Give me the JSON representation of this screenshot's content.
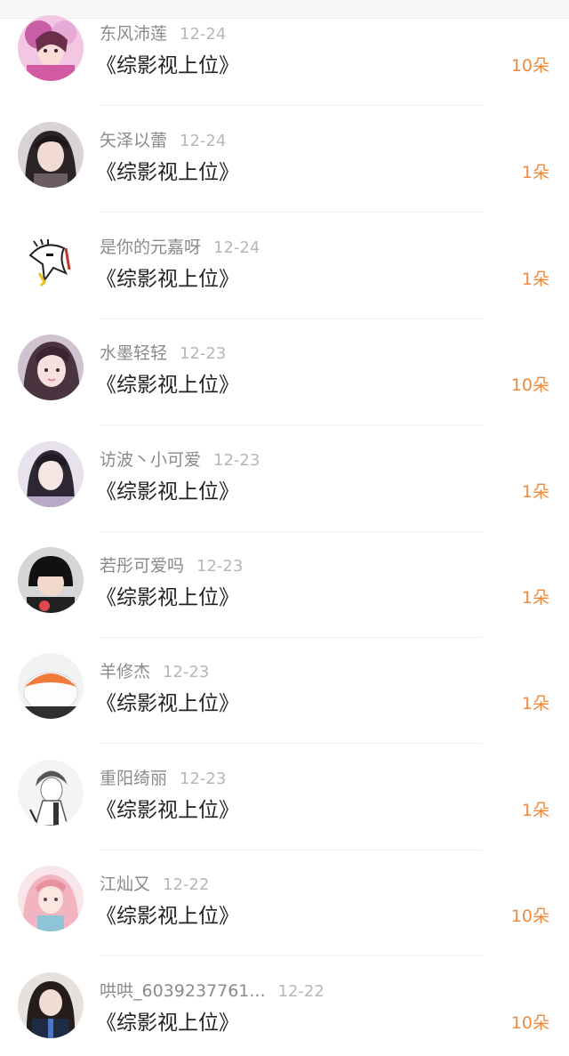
{
  "colors": {
    "accent": "#ef8a3c",
    "name_text": "#8a8a8a",
    "date_text": "#b7b7b7",
    "title_text": "#222222"
  },
  "rows": [
    {
      "name": "东风沛莲",
      "date": "12-24",
      "book": "《综影视上位》",
      "amount": "10朵",
      "avatar": "anime-girl-avatar"
    },
    {
      "name": "矢泽以蕾",
      "date": "12-24",
      "book": "《综影视上位》",
      "amount": "1朵",
      "avatar": "girl-photo-avatar"
    },
    {
      "name": "是你的元嘉呀",
      "date": "12-24",
      "book": "《综影视上位》",
      "amount": "1朵",
      "avatar": "sketch-bird-avatar"
    },
    {
      "name": "水墨轻轻",
      "date": "12-23",
      "book": "《综影视上位》",
      "amount": "10朵",
      "avatar": "girl-photo-avatar"
    },
    {
      "name": "访波丶小可爱",
      "date": "12-23",
      "book": "《综影视上位》",
      "amount": "1朵",
      "avatar": "girl-photo-avatar"
    },
    {
      "name": "若彤可爱吗",
      "date": "12-23",
      "book": "《综影视上位》",
      "amount": "1朵",
      "avatar": "child-photo-avatar"
    },
    {
      "name": "羊修杰",
      "date": "12-23",
      "book": "《综影视上位》",
      "amount": "1朵",
      "avatar": "sushi-avatar"
    },
    {
      "name": "重阳绮丽",
      "date": "12-23",
      "book": "《综影视上位》",
      "amount": "1朵",
      "avatar": "sketch-boy-avatar"
    },
    {
      "name": "江灿又",
      "date": "12-22",
      "book": "《综影视上位》",
      "amount": "10朵",
      "avatar": "anime-pink-hair-avatar"
    },
    {
      "name": "哄哄_6039237761...",
      "date": "12-22",
      "book": "《综影视上位》",
      "amount": "10朵",
      "avatar": "girl-photo-avatar"
    }
  ]
}
